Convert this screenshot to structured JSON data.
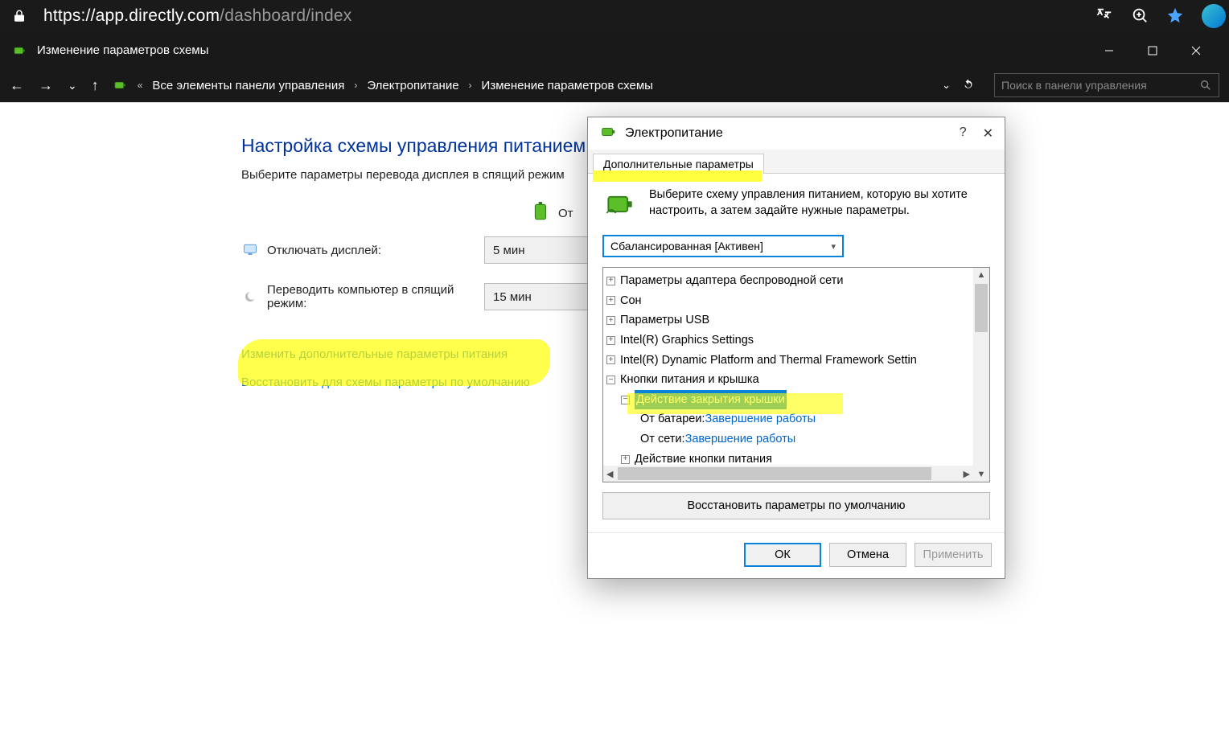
{
  "browser": {
    "url_secure_host": "https://app.directly.com",
    "url_path": "/dashboard/index"
  },
  "explorer": {
    "title": "Изменение параметров схемы",
    "breadcrumbs": {
      "root": "Все элементы панели управления",
      "mid": "Электропитание",
      "leaf": "Изменение параметров схемы"
    },
    "search_placeholder": "Поиск в панели управления"
  },
  "plan": {
    "heading_prefix": "Настройка схемы управления питанием \"",
    "subtitle": "Выберите параметры перевода дисплея в спящий режим",
    "battery_col_prefix": "От",
    "row1_label": "Отключать дисплей:",
    "row1_value": "5 мин",
    "row2_label": "Переводить компьютер в спящий режим:",
    "row2_value": "15 мин",
    "link1": "Изменить дополнительные параметры питания",
    "link2": "Восстановить для схемы параметры по умолчанию"
  },
  "dialog": {
    "title": "Электропитание",
    "tab": "Дополнительные параметры",
    "instructions": "Выберите схему управления питанием, которую вы хотите настроить, а затем задайте нужные параметры.",
    "scheme": "Сбалансированная [Активен]",
    "tree": {
      "n1": "Параметры адаптера беспроводной сети",
      "n2": "Сон",
      "n3": "Параметры USB",
      "n4": "Intel(R) Graphics Settings",
      "n5": "Intel(R) Dynamic Platform and Thermal Framework Settin",
      "n6": "Кнопки питания и крышка",
      "n7": "Действие закрытия крышки",
      "n8a": "От батареи: ",
      "n8b": "Завершение работы",
      "n9a": "От сети: ",
      "n9b": "Завершение работы",
      "n10": "Действие кнопки питания"
    },
    "restore": "Восстановить параметры по умолчанию",
    "ok": "ОК",
    "cancel": "Отмена",
    "apply": "Применить"
  }
}
